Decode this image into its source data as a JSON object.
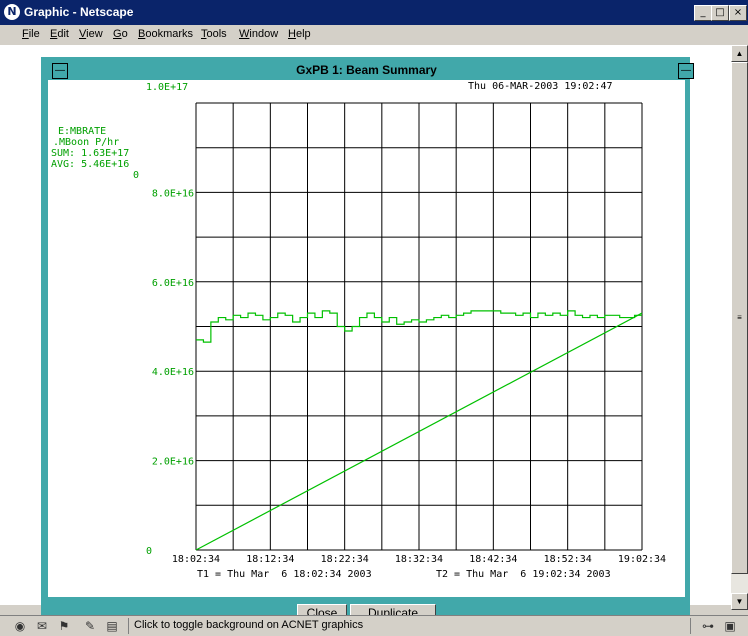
{
  "window": {
    "title": "Graphic - Netscape",
    "app_icon_glyph": "N",
    "minimize_glyph": "_",
    "maximize_glyph": "□",
    "close_glyph": "×"
  },
  "menu": [
    "File",
    "Edit",
    "View",
    "Go",
    "Bookmarks",
    "Tools",
    "Window",
    "Help"
  ],
  "inner_window": {
    "title": "GxPB 1: Beam Summary",
    "left_btn_glyph": "—",
    "right_btn_glyph": "—"
  },
  "plot": {
    "timestamp": "Thu 06-MAR-2003 19:02:47",
    "y_top_label": "1.0E+17",
    "legend": {
      "name": "E:MBRATE",
      "units": ".MBoon P/hr",
      "sum": "SUM: 1.63E+17",
      "avg": "AVG: 5.46E+16",
      "zero_marker": "0"
    },
    "t1_text": "T1 = Thu Mar  6 18:02:34 2003",
    "t2_text": "T2 = Thu Mar  6 19:02:34 2003"
  },
  "chart_data": {
    "type": "line",
    "title": "GxPB 1: Beam Summary",
    "xlabel": "",
    "ylabel": "",
    "x_ticks": [
      "18:02:34",
      "18:12:34",
      "18:22:34",
      "18:32:34",
      "18:42:34",
      "18:52:34",
      "19:02:34"
    ],
    "y_ticks": [
      "0",
      "2.0E+16",
      "4.0E+16",
      "6.0E+16",
      "8.0E+16",
      "1.0E+17"
    ],
    "ylim": [
      0,
      1e+17
    ],
    "xlim_minutes": [
      0,
      60
    ],
    "grid": true,
    "series": [
      {
        "name": "E:MBRATE",
        "color": "#00c000",
        "x_minutes": [
          0,
          1,
          2,
          3,
          4,
          5,
          6,
          7,
          8,
          9,
          10,
          11,
          12,
          13,
          14,
          15,
          16,
          17,
          18,
          19,
          20,
          21,
          22,
          23,
          24,
          25,
          26,
          27,
          28,
          29,
          30,
          31,
          32,
          33,
          34,
          35,
          36,
          37,
          38,
          39,
          40,
          41,
          42,
          43,
          44,
          45,
          46,
          47,
          48,
          49,
          50,
          51,
          52,
          53,
          54,
          55,
          56,
          57,
          58,
          59,
          60
        ],
        "values": [
          4.7e+16,
          4.65e+16,
          5.1e+16,
          5.2e+16,
          5.15e+16,
          5.25e+16,
          5.2e+16,
          5.3e+16,
          5.25e+16,
          5.15e+16,
          5.2e+16,
          5.3e+16,
          5.25e+16,
          5.1e+16,
          5.2e+16,
          5.3e+16,
          5.2e+16,
          5.35e+16,
          5.3e+16,
          5e+16,
          4.9e+16,
          5e+16,
          5.2e+16,
          5.3e+16,
          5.2e+16,
          5.1e+16,
          5.2e+16,
          5.05e+16,
          5.1e+16,
          5.15e+16,
          5.1e+16,
          5.15e+16,
          5.2e+16,
          5.25e+16,
          5.2e+16,
          5.25e+16,
          5.3e+16,
          5.35e+16,
          5.35e+16,
          5.35e+16,
          5.35e+16,
          5.3e+16,
          5.3e+16,
          5.25e+16,
          5.3e+16,
          5.2e+16,
          5.3e+16,
          5.25e+16,
          5.3e+16,
          5.25e+16,
          5.35e+16,
          5.25e+16,
          5.2e+16,
          5.25e+16,
          5.2e+16,
          5.25e+16,
          5.25e+16,
          5.2e+16,
          5.2e+16,
          5.25e+16,
          5.25e+16
        ]
      },
      {
        "name": "SUM",
        "color": "#00c000",
        "x_minutes": [
          0,
          60
        ],
        "values": [
          0,
          5.3e+16
        ]
      }
    ]
  },
  "buttons": {
    "close": "Close",
    "duplicate": "Duplicate"
  },
  "statusbar": {
    "text": "Click to toggle background on ACNET graphics",
    "icons": [
      "navigator-icon",
      "mail-icon",
      "aim-icon",
      "composer-icon",
      "address-book-icon"
    ]
  }
}
